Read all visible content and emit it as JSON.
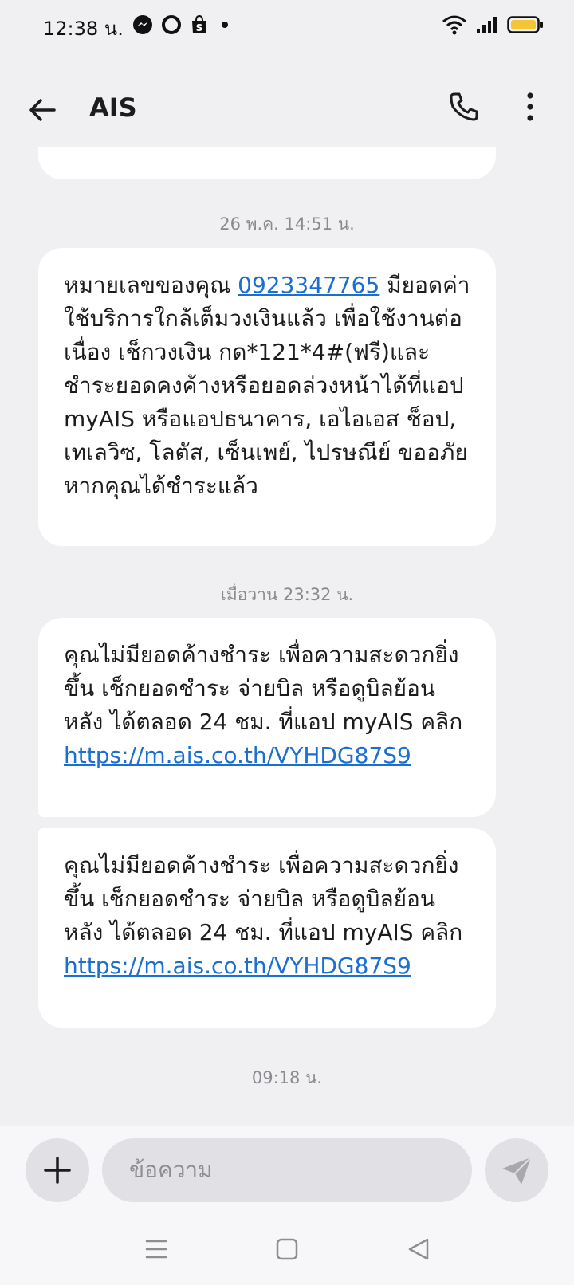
{
  "status_bar": {
    "time": "12:38 น.",
    "icons_left": [
      "messenger-icon",
      "circle-app-icon",
      "shopee-icon",
      "dot-icon"
    ],
    "icons_right": [
      "wifi-icon",
      "signal-icon",
      "battery-icon"
    ],
    "battery_color": "#f4c534"
  },
  "header": {
    "title": "AIS",
    "icons": [
      "back-arrow-icon",
      "phone-icon",
      "more-vert-icon"
    ]
  },
  "messages": [
    {
      "timestamp": "26 พ.ค. 14:51 น.",
      "text_before": "หมายเลขของคุณ ",
      "number": "0923347765",
      "text_after": " มียอดค่าใช้บริการใกล้เต็มวงเงินแล้ว เพื่อใช้งานต่อเนื่อง เช็กวงเงิน กด*121*4#(ฟรี)และชำระยอดคงค้างหรือยอดล่วงหน้าได้ที่แอป myAIS หรือแอปธนาคาร, เอไอเอส ช็อป, เทเลวิซ, โลตัส, เซ็นเพย์, ไปรษณีย์ ขออภัยหากคุณได้ชำระแล้ว"
    },
    {
      "timestamp": "เมื่อวาน 23:32 น.",
      "text": "คุณไม่มียอดค้างชำระ เพื่อความสะดวกยิ่งขึ้น เช็กยอดชำระ จ่ายบิล หรือดูบิลย้อนหลัง ได้ตลอด 24 ชม. ที่แอป myAIS คลิก",
      "link": "https://m.ais.co.th/VYHDG87S9"
    },
    {
      "text": "คุณไม่มียอดค้างชำระ เพื่อความสะดวกยิ่งขึ้น เช็กยอดชำระ จ่ายบิล หรือดูบิลย้อนหลัง ได้ตลอด 24 ชม. ที่แอป myAIS คลิก",
      "link": "https://m.ais.co.th/VYHDG87S9"
    },
    {
      "timestamp": "09:18 น."
    }
  ],
  "composer": {
    "placeholder": "ข้อความ",
    "icons": [
      "plus-icon",
      "send-icon"
    ]
  },
  "nav": {
    "icons": [
      "menu-nav-icon",
      "home-nav-icon",
      "back-nav-icon"
    ]
  },
  "colors": {
    "link": "#1a6fd1",
    "background": "#f0f0f3",
    "bubble": "#ffffff"
  }
}
